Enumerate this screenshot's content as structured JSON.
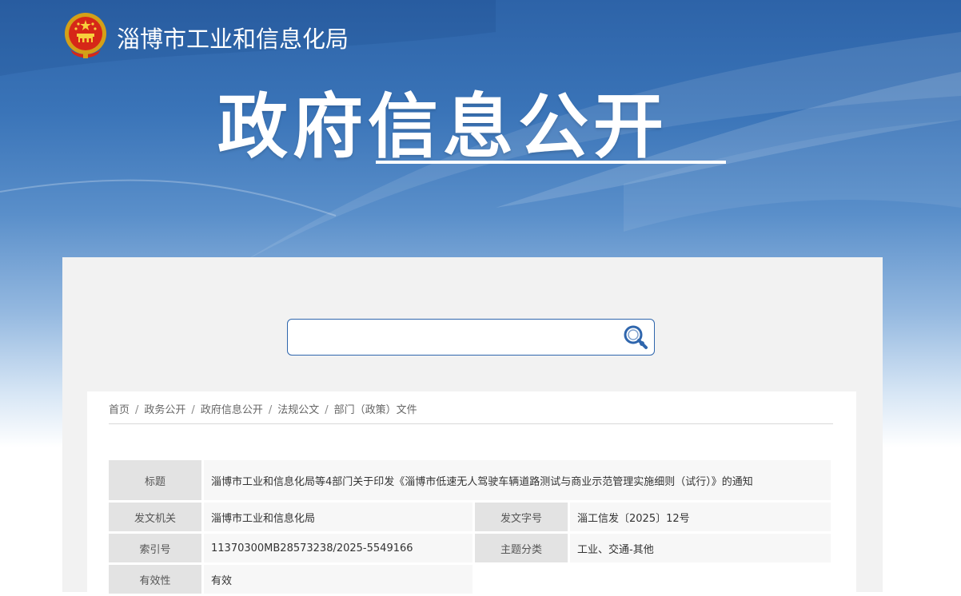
{
  "header": {
    "site_name": "淄博市工业和信息化局",
    "big_title": "政府信息公开",
    "emblem_icon": "national-emblem-icon"
  },
  "search": {
    "value": "",
    "placeholder": "",
    "button_icon": "search-icon"
  },
  "breadcrumb": [
    "首页",
    "政务公开",
    "政府信息公开",
    "法规公文",
    "部门（政策）文件"
  ],
  "meta": {
    "title_label": "标题",
    "title_value": "淄博市工业和信息化局等4部门关于印发《淄博市低速无人驾驶车辆道路测试与商业示范管理实施细则（试行）》的通知",
    "issuer_label": "发文机关",
    "issuer_value": "淄博市工业和信息化局",
    "doc_no_label": "发文字号",
    "doc_no_value": "淄工信发〔2025〕12号",
    "index_label": "索引号",
    "index_value": "11370300MB28573238/2025-5549166",
    "topic_label": "主题分类",
    "topic_value": "工业、交通-其他",
    "validity_label": "有效性",
    "validity_value": "有效"
  },
  "colors": {
    "accent": "#2f66ad",
    "panel_bg": "#f2f2f2",
    "label_bg": "#e3e3e3"
  }
}
